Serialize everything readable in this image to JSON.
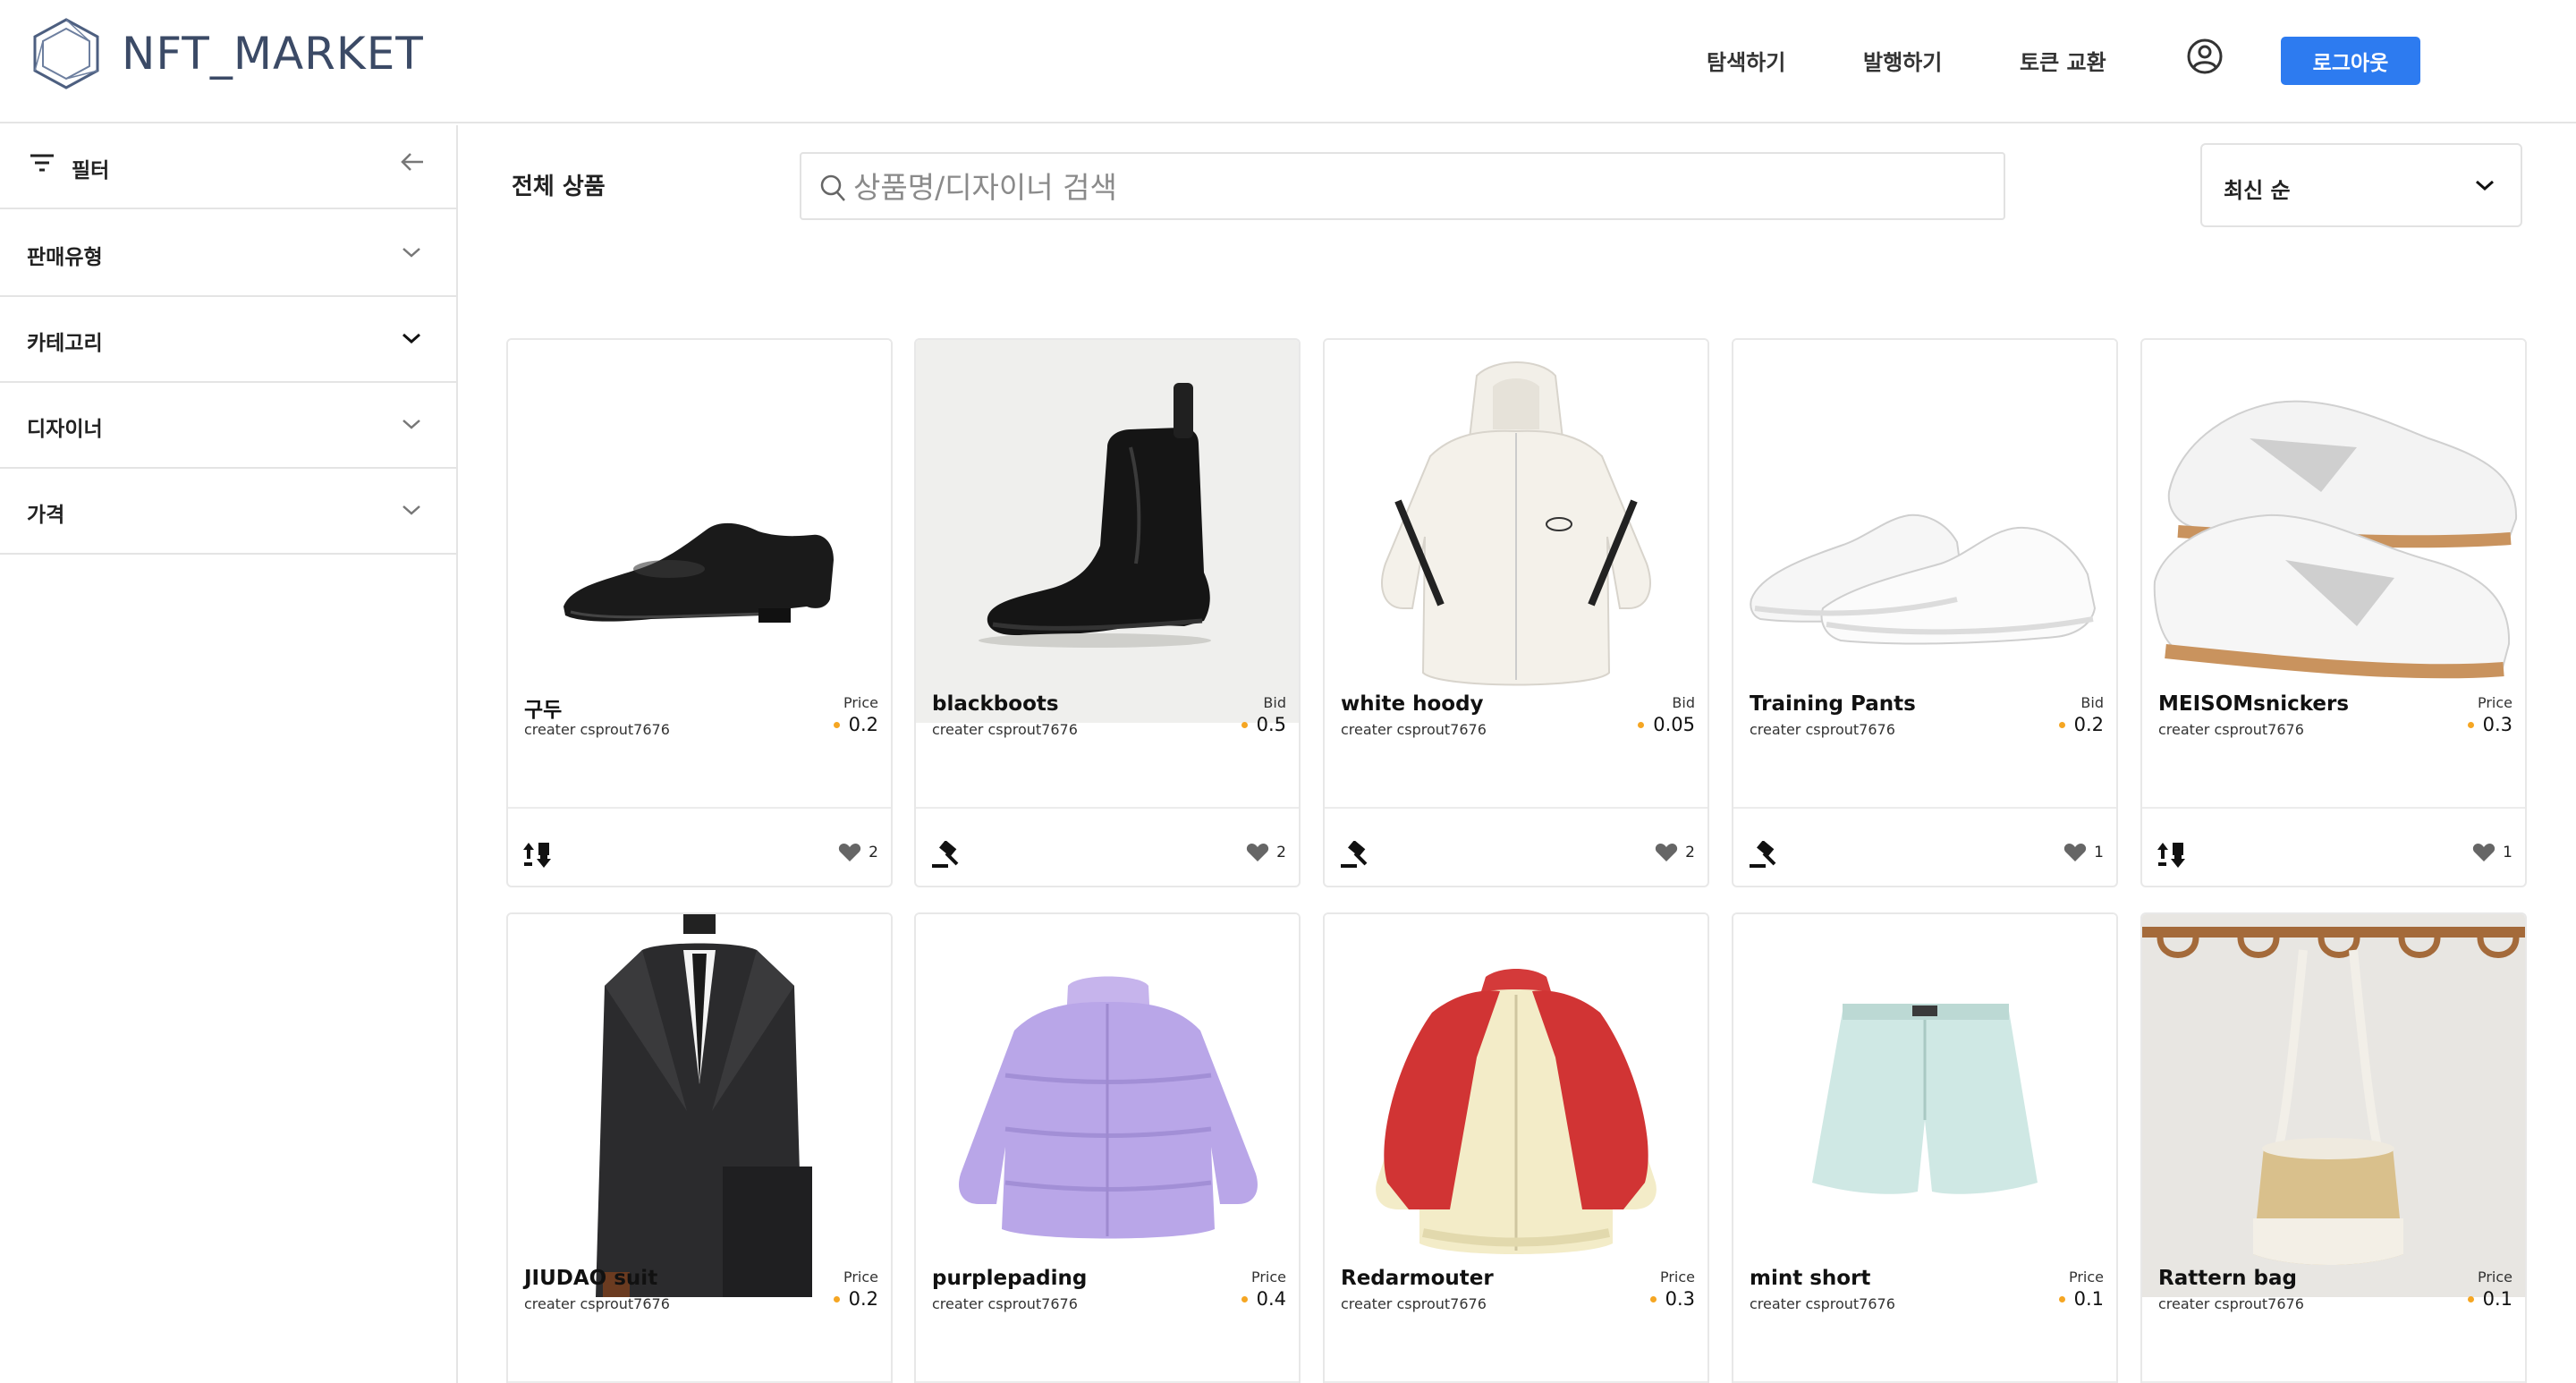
{
  "header": {
    "logo_text": "NFT_MARKET",
    "nav": [
      "탐색하기",
      "발행하기",
      "토큰 교환"
    ],
    "logout_label": "로그아웃"
  },
  "sidebar": {
    "filter_label": "필터",
    "sections": [
      "판매유형",
      "카테고리",
      "디자이너",
      "가격"
    ]
  },
  "main": {
    "title": "전체 상품",
    "search_placeholder": "상품명/디자이너 검색",
    "sort_label": "최신 순"
  },
  "products": [
    {
      "name": "구두",
      "creator": "creater csprout7676",
      "price_type": "Price",
      "price": "0.2",
      "sale_icon": "swap-icon",
      "likes": "2"
    },
    {
      "name": "blackboots",
      "creator": "creater csprout7676",
      "price_type": "Bid",
      "price": "0.5",
      "sale_icon": "gavel-icon",
      "likes": "2"
    },
    {
      "name": "white hoody",
      "creator": "creater csprout7676",
      "price_type": "Bid",
      "price": "0.05",
      "sale_icon": "gavel-icon",
      "likes": "2"
    },
    {
      "name": "Training Pants",
      "creator": "creater csprout7676",
      "price_type": "Bid",
      "price": "0.2",
      "sale_icon": "gavel-icon",
      "likes": "1"
    },
    {
      "name": "MEISOMsnickers",
      "creator": "creater csprout7676",
      "price_type": "Price",
      "price": "0.3",
      "sale_icon": "swap-icon",
      "likes": "1"
    },
    {
      "name": "JIUDAO suit",
      "creator": "creater csprout7676",
      "price_type": "Price",
      "price": "0.2"
    },
    {
      "name": "purplepading",
      "creator": "creater csprout7676",
      "price_type": "Price",
      "price": "0.4"
    },
    {
      "name": "Redarmouter",
      "creator": "creater csprout7676",
      "price_type": "Price",
      "price": "0.3"
    },
    {
      "name": "mint short",
      "creator": "creater csprout7676",
      "price_type": "Price",
      "price": "0.1"
    },
    {
      "name": "Rattern bag",
      "creator": "creater csprout7676",
      "price_type": "Price",
      "price": "0.1"
    }
  ],
  "colors": {
    "accent": "#2d7bf0",
    "price_dot": "#f5a623",
    "logo": "#3b4a66"
  }
}
